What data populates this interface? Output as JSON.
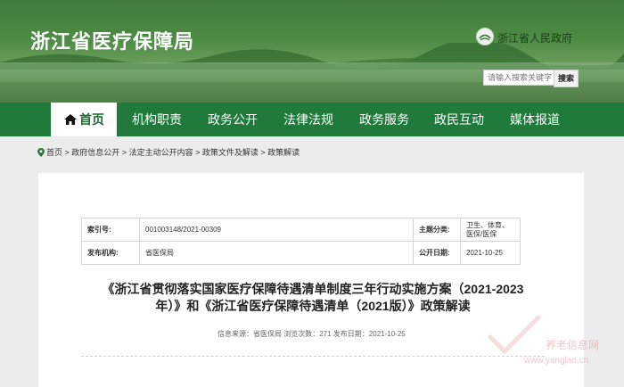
{
  "header": {
    "site_title": "浙江省医疗保障局",
    "gov_name": "浙江省人民政府",
    "search_placeholder": "请输入搜索关键字",
    "search_button": "搜索"
  },
  "nav": {
    "items": [
      "首页",
      "机构职责",
      "政务公开",
      "法律法规",
      "政务服务",
      "政民互动",
      "媒体报道"
    ],
    "active": "首页"
  },
  "breadcrumb": [
    "首页",
    "政府信息公开",
    "法定主动公开内容",
    "政策文件及解读",
    "政策解读"
  ],
  "meta": {
    "index_label": "索引号:",
    "index_value": "001003148/2021-00309",
    "topic_label": "主题分类:",
    "topic_value": "卫生、体育、医保/医保",
    "publisher_label": "发布机构:",
    "publisher_value": "省医保局",
    "date_label": "公开日期:",
    "date_value": "2021-10-25"
  },
  "article": {
    "title_line1": "《浙江省贯彻落实国家医疗保障待遇清单制度三年行动实施方案（2021-2023",
    "title_line2": "年）》和《浙江省医疗保障待遇清单（2021版）》政策解读",
    "info": "信息来源：省医保局 浏览次数：271 发布日期：2021-10-25"
  },
  "watermark": {
    "text": "养老信息网",
    "url": "www.yanglao.cn"
  },
  "colors": {
    "nav_green": "#1f7a3c",
    "home_text_green": "#1d6a33"
  }
}
